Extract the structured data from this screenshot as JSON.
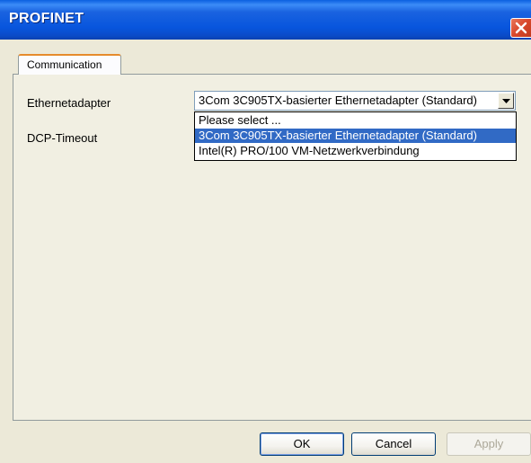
{
  "window": {
    "title": "PROFINET",
    "close_icon": "close-icon"
  },
  "tabs": [
    {
      "label": "Communication",
      "active": true
    }
  ],
  "form": {
    "ethernet_adapter_label": "Ethernetadapter",
    "dcp_timeout_label": "DCP-Timeout",
    "ethernet_adapter_value": "3Com 3C905TX-basierter Ethernetadapter (Standard)",
    "dropdown_arrow_icon": "chevron-down-icon",
    "dropdown_options": [
      {
        "label": "Please select ...",
        "selected": false
      },
      {
        "label": "3Com 3C905TX-basierter Ethernetadapter (Standard)",
        "selected": true
      },
      {
        "label": "Intel(R) PRO/100 VM-Netzwerkverbindung",
        "selected": false
      }
    ]
  },
  "buttons": {
    "ok": "OK",
    "cancel": "Cancel",
    "apply": "Apply"
  },
  "colors": {
    "titlebar": "#0855dd",
    "close_button": "#d8472b",
    "selection": "#316ac5",
    "tab_accent": "#e68b2c"
  }
}
